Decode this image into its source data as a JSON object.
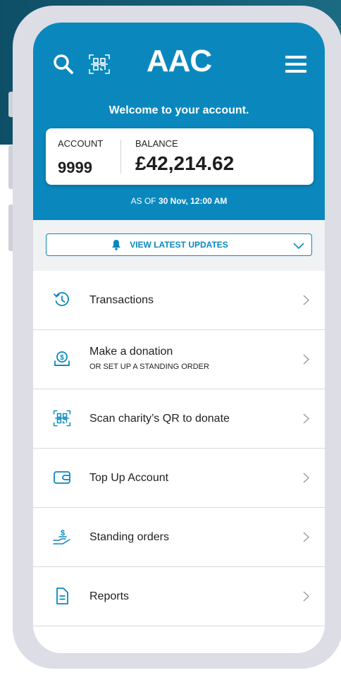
{
  "header": {
    "logo": "AAC",
    "welcome": "Welcome to your account.",
    "account_label": "ACCOUNT",
    "account_number": "9999",
    "balance_label": "BALANCE",
    "balance_value": "£42,214.62",
    "as_of_prefix": "AS OF",
    "as_of_value": "30 Nov, 12:00 AM"
  },
  "updates": {
    "label": "VIEW LATEST UPDATES"
  },
  "menu": [
    {
      "title": "Transactions",
      "subtitle": "",
      "icon": "history-icon"
    },
    {
      "title": "Make a donation",
      "subtitle": "OR SET UP A STANDING ORDER",
      "icon": "donation-icon"
    },
    {
      "title": "Scan charity’s QR to donate",
      "subtitle": "",
      "icon": "qr-code-icon"
    },
    {
      "title": "Top Up Account",
      "subtitle": "",
      "icon": "wallet-icon"
    },
    {
      "title": "Standing orders",
      "subtitle": "",
      "icon": "hand-money-icon"
    },
    {
      "title": "Reports",
      "subtitle": "",
      "icon": "document-icon"
    }
  ],
  "colors": {
    "brand": "#0a88bd",
    "backdrop": "#0e4f67",
    "phone_frame": "#dcdde5"
  }
}
